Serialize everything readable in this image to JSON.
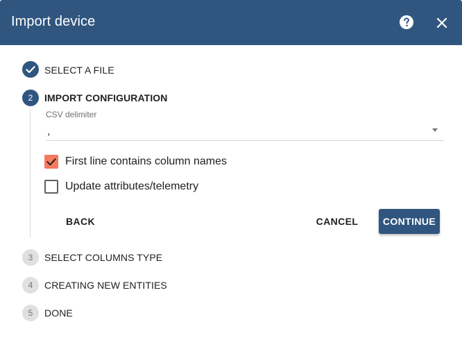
{
  "dialog": {
    "title": "Import device",
    "help_icon": "help-circle-icon",
    "close_icon": "close-icon"
  },
  "steps": [
    {
      "number": "1",
      "label": "Select a file",
      "state": "completed"
    },
    {
      "number": "2",
      "label": "Import configuration",
      "state": "active"
    },
    {
      "number": "3",
      "label": "Select columns type",
      "state": "pending"
    },
    {
      "number": "4",
      "label": "Creating new entities",
      "state": "pending"
    },
    {
      "number": "5",
      "label": "Done",
      "state": "pending"
    }
  ],
  "config": {
    "delimiter_label": "CSV delimiter",
    "delimiter_value": ",",
    "first_line_label": "First line contains column names",
    "first_line_checked": true,
    "update_attributes_label": "Update attributes/telemetry",
    "update_attributes_checked": false
  },
  "actions": {
    "back_label": "Back",
    "cancel_label": "Cancel",
    "continue_label": "Continue"
  },
  "colors": {
    "primary": "#305680",
    "accent": "#f4795f",
    "pending_step": "#e0e0e0"
  }
}
